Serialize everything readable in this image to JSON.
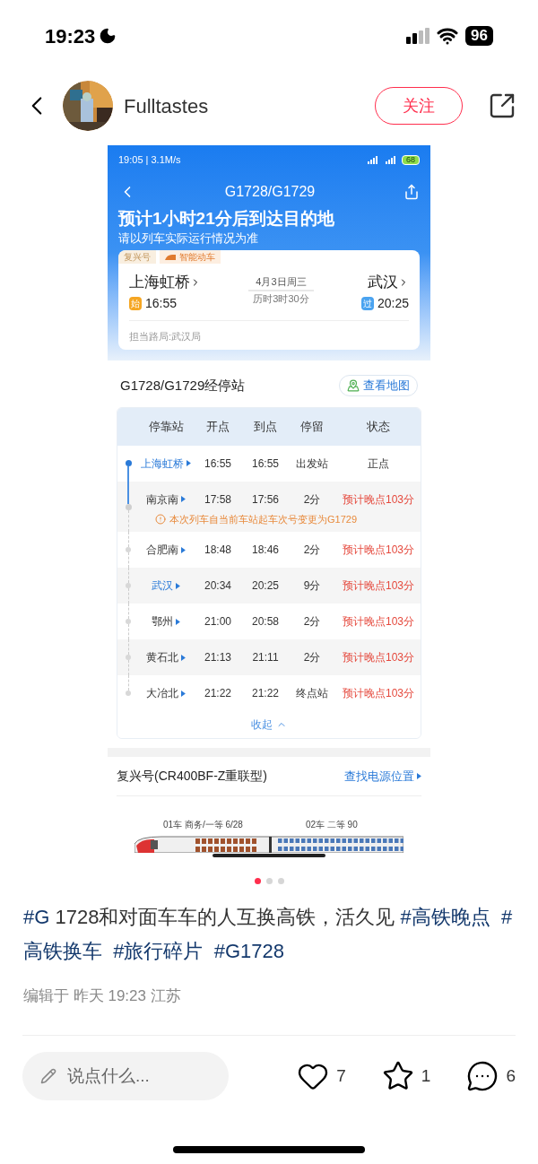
{
  "status_bar": {
    "time": "19:23",
    "battery": "96"
  },
  "header": {
    "author": "Fulltastes",
    "follow_label": "关注"
  },
  "screenshot": {
    "status_bar": {
      "time": "19:05 | 3.1M/s",
      "battery": "68"
    },
    "nav_title": "G1728/G1729",
    "headline": "预计1小时21分后到达目的地",
    "subtitle": "请以列车实际运行情况为准",
    "trip_card": {
      "tags": [
        {
          "label": "复兴号",
          "kind": "plain"
        },
        {
          "label": "智能动车",
          "kind": "smart"
        }
      ],
      "from": {
        "station": "上海虹桥",
        "badge": "始",
        "kind": "start",
        "time": "16:55"
      },
      "date": "4月3日周三",
      "duration": "历时3时30分",
      "to": {
        "station": "武汉",
        "badge": "过",
        "kind": "pass",
        "time": "20:25"
      },
      "bureau": "担当路局:武汉局"
    },
    "stops": {
      "title": "G1728/G1729经停站",
      "map_button": "查看地图",
      "columns": [
        "停靠站",
        "开点",
        "到点",
        "停留",
        "状态"
      ],
      "rows": [
        {
          "station": "上海虹桥",
          "depart": "16:55",
          "arrive": "16:55",
          "stay": "出发站",
          "status": "正点",
          "late": false,
          "highlighted": true,
          "passed": true
        },
        {
          "station": "南京南",
          "depart": "17:58",
          "arrive": "17:56",
          "stay": "2分",
          "status": "预计晚点103分",
          "late": true,
          "highlighted": false,
          "passed": true,
          "note": "本次列车自当前车站起车次号变更为G1729"
        },
        {
          "station": "合肥南",
          "depart": "18:48",
          "arrive": "18:46",
          "stay": "2分",
          "status": "预计晚点103分",
          "late": true,
          "highlighted": false,
          "passed": false
        },
        {
          "station": "武汉",
          "depart": "20:34",
          "arrive": "20:25",
          "stay": "9分",
          "status": "预计晚点103分",
          "late": true,
          "highlighted": true,
          "passed": false
        },
        {
          "station": "鄂州",
          "depart": "21:00",
          "arrive": "20:58",
          "stay": "2分",
          "status": "预计晚点103分",
          "late": true,
          "highlighted": false,
          "passed": false
        },
        {
          "station": "黄石北",
          "depart": "21:13",
          "arrive": "21:11",
          "stay": "2分",
          "status": "预计晚点103分",
          "late": true,
          "highlighted": false,
          "passed": false
        },
        {
          "station": "大冶北",
          "depart": "21:22",
          "arrive": "21:22",
          "stay": "终点站",
          "status": "预计晚点103分",
          "late": true,
          "highlighted": false,
          "passed": false
        }
      ],
      "collapse": "收起"
    },
    "train": {
      "model": "复兴号(CR400BF-Z重联型)",
      "power_link": "查找电源位置",
      "cars": [
        "01车 商务/一等 6/28",
        "02车 二等 90"
      ]
    }
  },
  "carousel": [
    {
      "selected": true
    },
    {
      "selected": false
    },
    {
      "selected": false
    }
  ],
  "caption": [
    {
      "text": "#G",
      "kind": "tag"
    },
    {
      "text": " 1728和对面车车的人互换高铁，活久见 ",
      "kind": "plain"
    },
    {
      "text": "#高铁晚点  ",
      "kind": "tag"
    },
    {
      "text": "#高铁换车  ",
      "kind": "tag"
    },
    {
      "text": "#旅行碎片  ",
      "kind": "tag"
    },
    {
      "text": "#G1728",
      "kind": "tag"
    }
  ],
  "meta": "编辑于 昨天 19:23 江苏",
  "bottom_bar": {
    "placeholder": "说点什么...",
    "likes": "7",
    "stars": "1",
    "comments": "6"
  }
}
